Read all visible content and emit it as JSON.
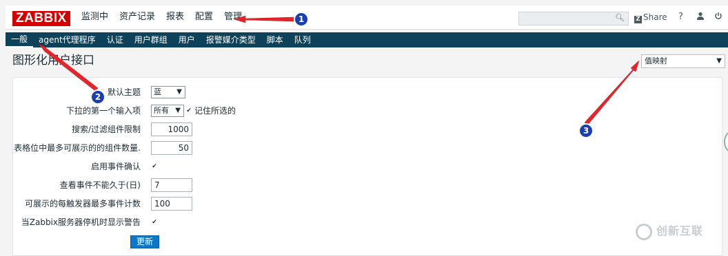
{
  "logo": "ZABBIX",
  "main_nav": [
    "监测中",
    "资产记录",
    "报表",
    "配置",
    "管理"
  ],
  "topbar": {
    "search_placeholder": "",
    "share_label": "Share",
    "share_icon": "Z",
    "help_label": "?",
    "user_icon": "user-icon",
    "logout_icon": "power-icon"
  },
  "sub_nav": [
    "一般",
    "agent代理程序",
    "认证",
    "用户群组",
    "用户",
    "报警媒介类型",
    "脚本",
    "队列"
  ],
  "page": {
    "title": "图形化用户接口",
    "view_select": "值映射"
  },
  "form": {
    "default_theme": {
      "label": "默认主题",
      "value": "蓝"
    },
    "dropdown_first": {
      "label": "下拉的第一个输入项",
      "value": "所有",
      "remember_label": "记住所选的",
      "remember_checked": true
    },
    "search_limit": {
      "label": "搜索/过滤组件限制",
      "value": "1000"
    },
    "max_table_elements": {
      "label": "表格位中最多可展示的的组件数量.",
      "value": "50"
    },
    "event_ack": {
      "label": "启用事件确认",
      "checked": true
    },
    "event_max_age": {
      "label": "查看事件不能久于(日)",
      "value": "7"
    },
    "max_events_per_trigger": {
      "label": "可展示的每触发器最多事件计数",
      "value": "100"
    },
    "server_down_warning": {
      "label": "当Zabbix服务器停机时显示警告",
      "checked": true
    },
    "update_button": "更新"
  },
  "annotations": [
    "1",
    "2",
    "3"
  ],
  "watermark": "创新互联",
  "colors": {
    "logo_red": "#d40000",
    "subnav_bg": "#0e425a",
    "button_blue": "#0e78c6",
    "annotation_red": "#e8242a",
    "badge_blue": "#1a3fb0"
  }
}
